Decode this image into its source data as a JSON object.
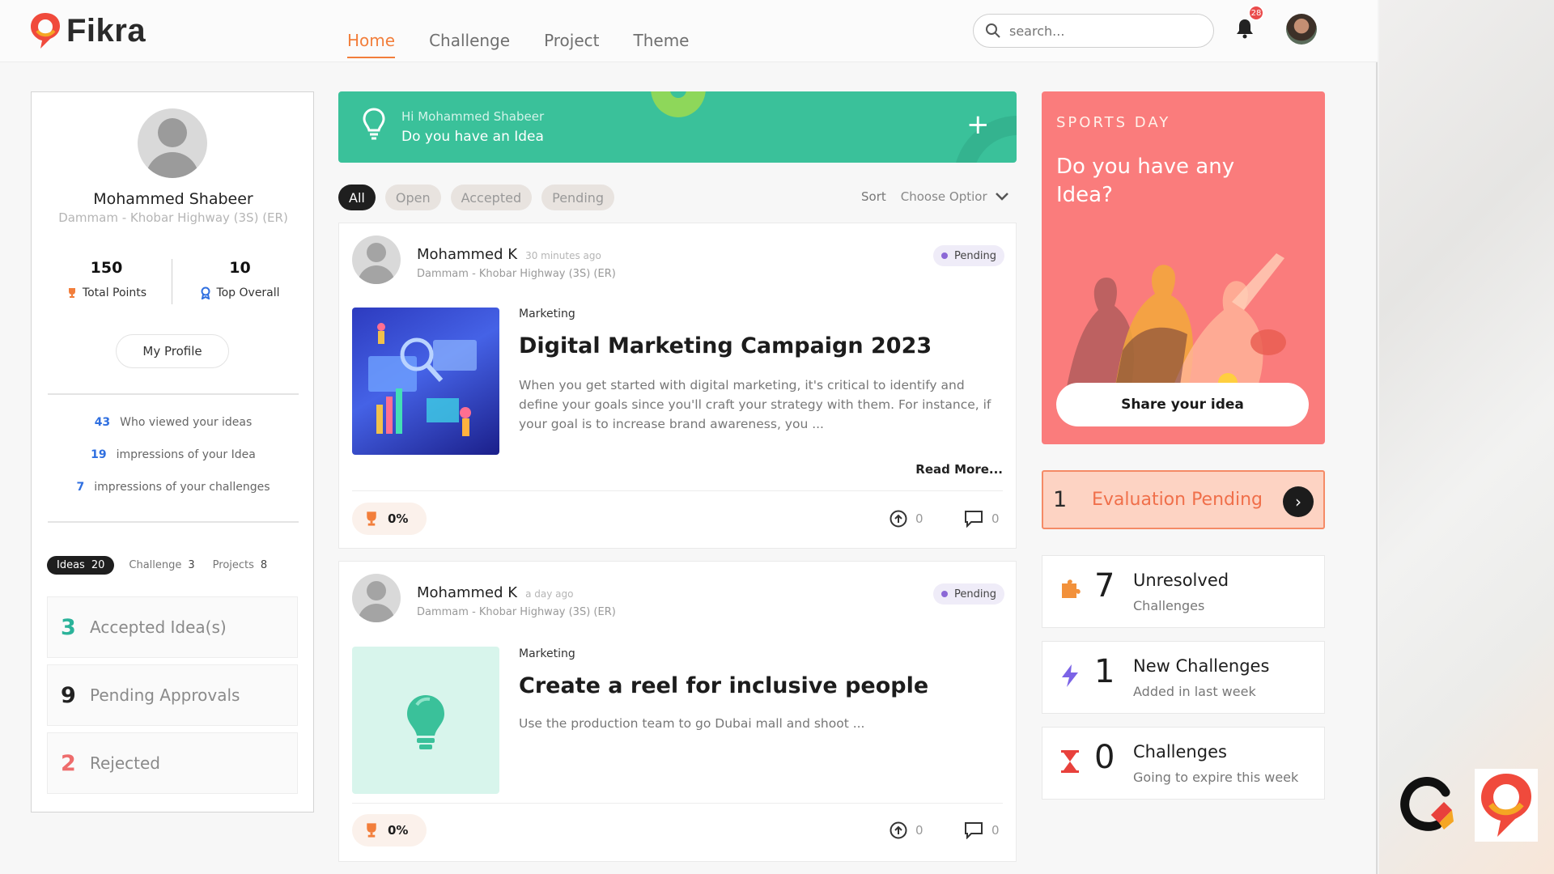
{
  "app": {
    "name": "Fikra"
  },
  "nav": {
    "items": [
      "Home",
      "Challenge",
      "Project",
      "Theme"
    ],
    "active": "Home"
  },
  "search": {
    "placeholder": "search..."
  },
  "notifications": {
    "count": "28"
  },
  "profile": {
    "name": "Mohammed Shabeer",
    "location": "Dammam - Khobar Highway (3S) (ER)",
    "total_points": "150",
    "total_points_label": "Total Points",
    "top_overall": "10",
    "top_overall_label": "Top Overall",
    "my_profile_label": "My Profile",
    "views": [
      {
        "n": "43",
        "label": "Who viewed your ideas"
      },
      {
        "n": "19",
        "label": "impressions of your Idea"
      },
      {
        "n": "7",
        "label": "impressions of your challenges"
      }
    ],
    "tabs": {
      "ideas_label": "Ideas",
      "ideas_count": "20",
      "challenge_label": "Challenge",
      "challenge_count": "3",
      "projects_label": "Projects",
      "projects_count": "8"
    },
    "counts": [
      {
        "n": "3",
        "label": "Accepted Idea(s)",
        "color": "#2bb39a"
      },
      {
        "n": "9",
        "label": "Pending Approvals",
        "color": "#222222"
      },
      {
        "n": "2",
        "label": "Rejected",
        "color": "#ee6c6c"
      }
    ]
  },
  "banner": {
    "greeting": "Hi Mohammed Shabeer",
    "question": "Do you have an Idea",
    "plus": "+"
  },
  "filters": {
    "items": [
      "All",
      "Open",
      "Accepted",
      "Pending"
    ],
    "active": "All",
    "sort_label": "Sort",
    "sort_value": "Choose Optior"
  },
  "posts": [
    {
      "author": "Mohammed K",
      "time": "30 minutes ago",
      "location": "Dammam - Khobar Highway (3S) (ER)",
      "status": "Pending",
      "category": "Marketing",
      "title": "Digital Marketing Campaign 2023",
      "description": "When you get started with digital marketing, it's critical to identify and define your goals since you'll craft your strategy with them. For instance, if your goal is to increase brand awareness, you ...",
      "read_more": "Read More...",
      "score": "0%",
      "upvotes": "0",
      "comments": "0"
    },
    {
      "author": "Mohammed K",
      "time": "a day ago",
      "location": "Dammam - Khobar Highway (3S) (ER)",
      "status": "Pending",
      "category": "Marketing",
      "title": "Create a reel for inclusive people",
      "description": "Use the production team to go Dubai mall and shoot ...",
      "score": "0%",
      "upvotes": "0",
      "comments": "0"
    }
  ],
  "sports": {
    "tag": "SPORTS DAY",
    "question": "Do you have any Idea?",
    "button": "Share your idea"
  },
  "evaluation": {
    "count": "1",
    "label": "Evaluation Pending"
  },
  "stats": [
    {
      "icon": "puzzle-icon",
      "n": "7",
      "title": "Unresolved",
      "subtitle": "Challenges"
    },
    {
      "icon": "lightning-icon",
      "n": "1",
      "title": "New Challenges",
      "subtitle": "Added in last week"
    },
    {
      "icon": "hourglass-icon",
      "n": "0",
      "title": "Challenges",
      "subtitle": "Going to expire this week"
    }
  ],
  "colors": {
    "accent": "#f27e3b",
    "banner": "#3ac19a",
    "sports": "#fa7c7c",
    "eval_border": "#f58a66"
  }
}
